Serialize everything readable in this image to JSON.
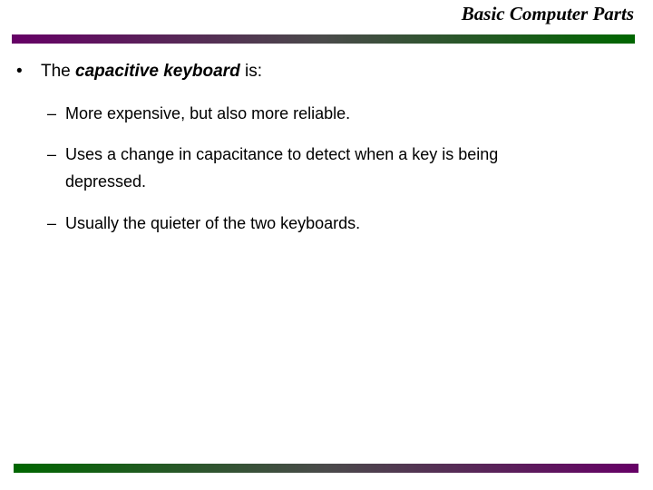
{
  "header": {
    "title": "Basic Computer Parts",
    "bar_colors": [
      "#660066",
      "#006600"
    ]
  },
  "content": {
    "bullet": {
      "marker": "•",
      "prefix": "The ",
      "emphasis": "capacitive keyboard",
      "suffix": " is:"
    },
    "sub_items": [
      {
        "marker": "–",
        "text": "More expensive, but also more reliable."
      },
      {
        "marker": "–",
        "text": "Uses a change in capacitance to detect when a key is being depressed."
      },
      {
        "marker": "–",
        "text": "Usually the quieter of the two keyboards."
      }
    ]
  },
  "footer": {
    "bar_colors": [
      "#006600",
      "#660066"
    ]
  }
}
